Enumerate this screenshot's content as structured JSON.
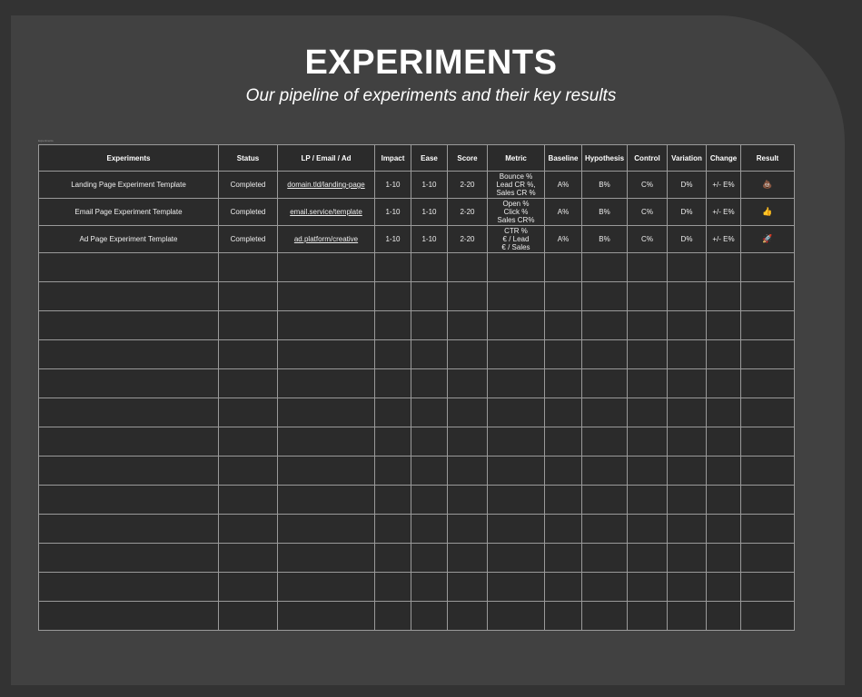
{
  "header": {
    "title": "EXPERIMENTS",
    "subtitle": "Our pipeline of experiments and their key results",
    "tiny_label": "Experiments"
  },
  "table": {
    "columns": [
      "Experiments",
      "Status",
      "LP / Email / Ad",
      "Impact",
      "Ease",
      "Score",
      "Metric",
      "Baseline",
      "Hypothesis",
      "Control",
      "Variation",
      "Change",
      "Result"
    ],
    "rows": [
      {
        "experiment": "Landing Page Experiment Template",
        "status": "Completed",
        "link": "domain.tld/landing-page",
        "impact": "1-10",
        "ease": "1-10",
        "score": "2-20",
        "metric": [
          "Bounce %",
          "Lead CR %,",
          "Sales CR %"
        ],
        "baseline": "A%",
        "hypothesis": "B%",
        "control": "C%",
        "variation": "D%",
        "change": "+/- E%",
        "result": "💩",
        "result_icon": "poop-icon"
      },
      {
        "experiment": "Email Page Experiment Template",
        "status": "Completed",
        "link": "email.service/template",
        "impact": "1-10",
        "ease": "1-10",
        "score": "2-20",
        "metric": [
          "Open %",
          "Click %",
          "Sales CR%"
        ],
        "baseline": "A%",
        "hypothesis": "B%",
        "control": "C%",
        "variation": "D%",
        "change": "+/- E%",
        "result": "👍",
        "result_icon": "thumbs-up-icon"
      },
      {
        "experiment": "Ad Page Experiment Template",
        "status": "Completed",
        "link": "ad.platform/creative",
        "impact": "1-10",
        "ease": "1-10",
        "score": "2-20",
        "metric": [
          "CTR %",
          "€ / Lead",
          "€ / Sales"
        ],
        "baseline": "A%",
        "hypothesis": "B%",
        "control": "C%",
        "variation": "D%",
        "change": "+/- E%",
        "result": "🚀",
        "result_icon": "rocket-icon"
      }
    ],
    "empty_row_count": 13
  }
}
